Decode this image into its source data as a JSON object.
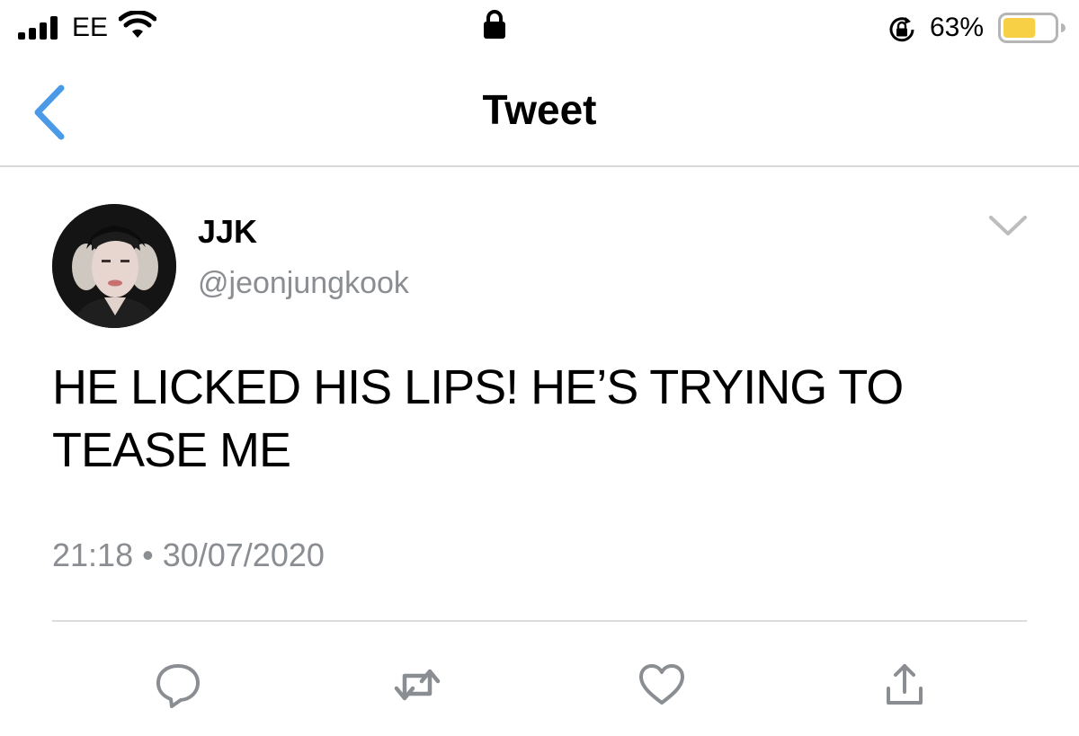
{
  "status_bar": {
    "carrier": "EE",
    "battery_percent": "63%",
    "signal_icon": "signal-bars-icon",
    "wifi_icon": "wifi-icon",
    "lock_icon": "lock-icon",
    "rotation_lock_icon": "rotation-lock-icon",
    "battery_icon": "battery-icon",
    "battery_level": 0.63,
    "battery_color": "#f7d046"
  },
  "nav": {
    "title": "Tweet",
    "back_icon": "chevron-left-icon",
    "accent_color": "#4a9ae8"
  },
  "tweet": {
    "display_name": "JJK",
    "handle": "@jeonjungkook",
    "text": "HE LICKED HIS LIPS! HE’S TRYING TO TEASE ME",
    "time": "21:18",
    "separator": "•",
    "date": "30/07/2020",
    "more_icon": "chevron-down-icon"
  },
  "actions": [
    {
      "name": "reply",
      "icon": "reply-icon"
    },
    {
      "name": "retweet",
      "icon": "retweet-icon"
    },
    {
      "name": "like",
      "icon": "heart-icon"
    },
    {
      "name": "share",
      "icon": "share-icon"
    }
  ],
  "colors": {
    "secondary_text": "#8a8d91",
    "icon_gray": "#8a8d91",
    "divider": "#dcdcdc"
  }
}
